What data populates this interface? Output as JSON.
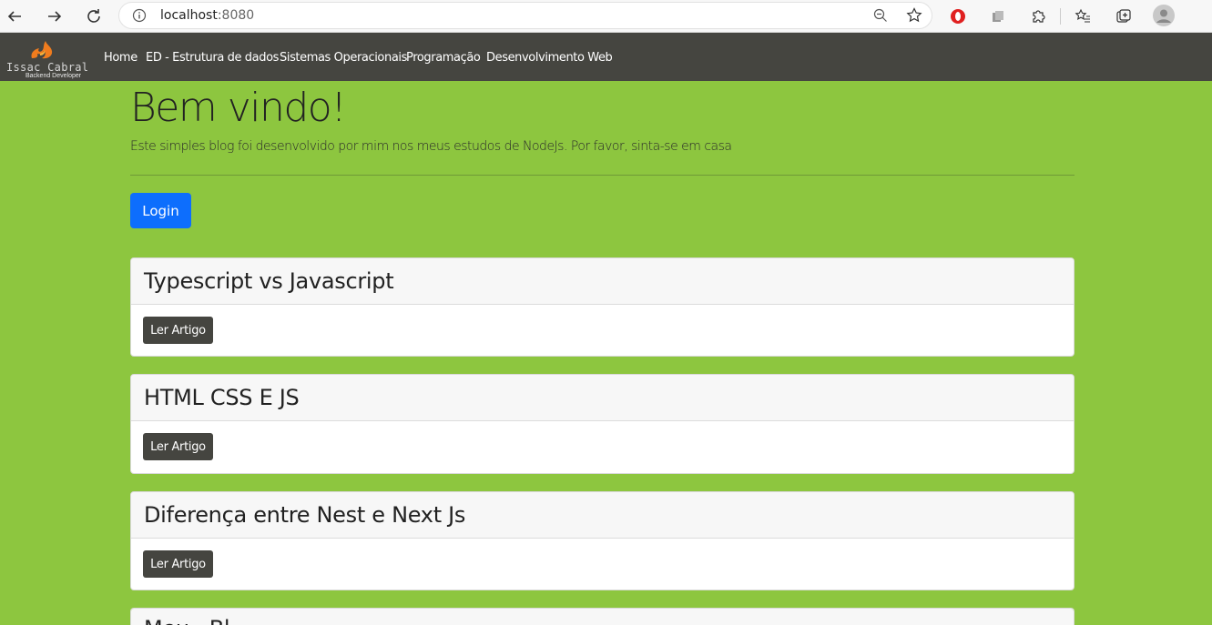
{
  "browser": {
    "url_host": "localhost",
    "url_port": ":8080"
  },
  "brand": {
    "title": "Issac Cabral",
    "subtitle": "Backend Developer"
  },
  "nav": {
    "items": [
      {
        "label": "Home"
      },
      {
        "label": "ED - Estrutura de dados"
      },
      {
        "label": "Sistemas Operacionais"
      },
      {
        "label": "Programação"
      },
      {
        "label": "Desenvolvimento Web"
      }
    ]
  },
  "hero": {
    "title": "Bem vindo!",
    "lead": "Este simples blog foi desenvolvido por mim nos meus estudos de NodeJs. Por favor, sinta-se em casa",
    "login_label": "Login"
  },
  "articles": [
    {
      "title": "Typescript vs Javascript",
      "button": "Ler Artigo"
    },
    {
      "title": "HTML CSS E JS",
      "button": "Ler Artigo"
    },
    {
      "title": "Diferença entre Nest e Next Js",
      "button": "Ler Artigo"
    },
    {
      "title": "Meu...Bl...",
      "button": ""
    }
  ],
  "colors": {
    "page_bg": "#8dc63f",
    "navbar_bg": "#454540",
    "primary": "#0d6efd"
  }
}
